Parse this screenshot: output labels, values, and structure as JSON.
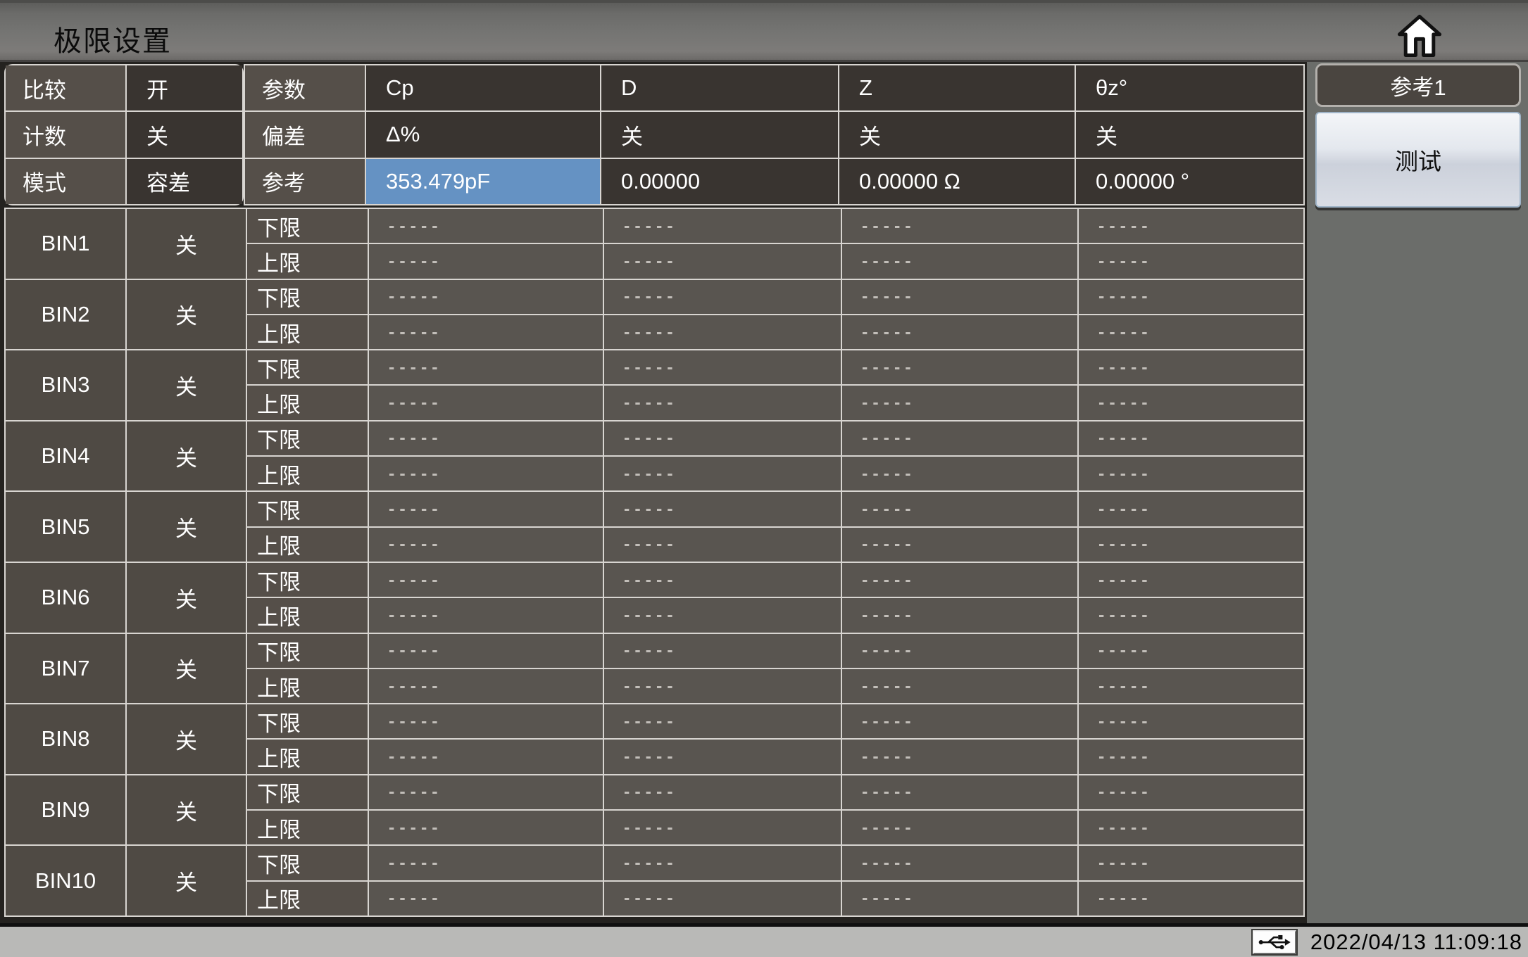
{
  "window": {
    "title": "极限设置"
  },
  "comparator_panel": {
    "rows": [
      {
        "label": "比较",
        "value": "开"
      },
      {
        "label": "计数",
        "value": "关"
      },
      {
        "label": "模式",
        "value": "容差"
      }
    ]
  },
  "param_table": {
    "param_row": {
      "label": "参数",
      "values": [
        "Cp",
        "D",
        "Z",
        "θz°"
      ]
    },
    "deviation_row": {
      "label": "偏差",
      "values": [
        "Δ%",
        "关",
        "关",
        "关"
      ]
    },
    "reference_row": {
      "label": "参考",
      "values": [
        "353.479pF",
        "0.00000",
        "0.00000 Ω",
        "0.00000 °"
      ]
    }
  },
  "side_buttons": {
    "reference_page": "参考1",
    "test": "测试"
  },
  "bin_table": {
    "limit_labels": [
      "下限",
      "上限"
    ],
    "dash_placeholder": "-----",
    "bins": [
      {
        "name": "BIN1",
        "state": "关"
      },
      {
        "name": "BIN2",
        "state": "关"
      },
      {
        "name": "BIN3",
        "state": "关"
      },
      {
        "name": "BIN4",
        "state": "关"
      },
      {
        "name": "BIN5",
        "state": "关"
      },
      {
        "name": "BIN6",
        "state": "关"
      },
      {
        "name": "BIN7",
        "state": "关"
      },
      {
        "name": "BIN8",
        "state": "关"
      },
      {
        "name": "BIN9",
        "state": "关"
      },
      {
        "name": "BIN10",
        "state": "关"
      }
    ]
  },
  "status_bar": {
    "datetime": "2022/04/13 11:09:18"
  },
  "colors": {
    "highlight_blue": "#6592c3",
    "cell_value_dark": "#393430",
    "cell_label": "#554f49",
    "cell_value_gray": "#595550",
    "sidebar_gray": "#6b6d6a",
    "statusbar_gray": "#b9b9b7",
    "grid_line": "#d8d5d1"
  }
}
